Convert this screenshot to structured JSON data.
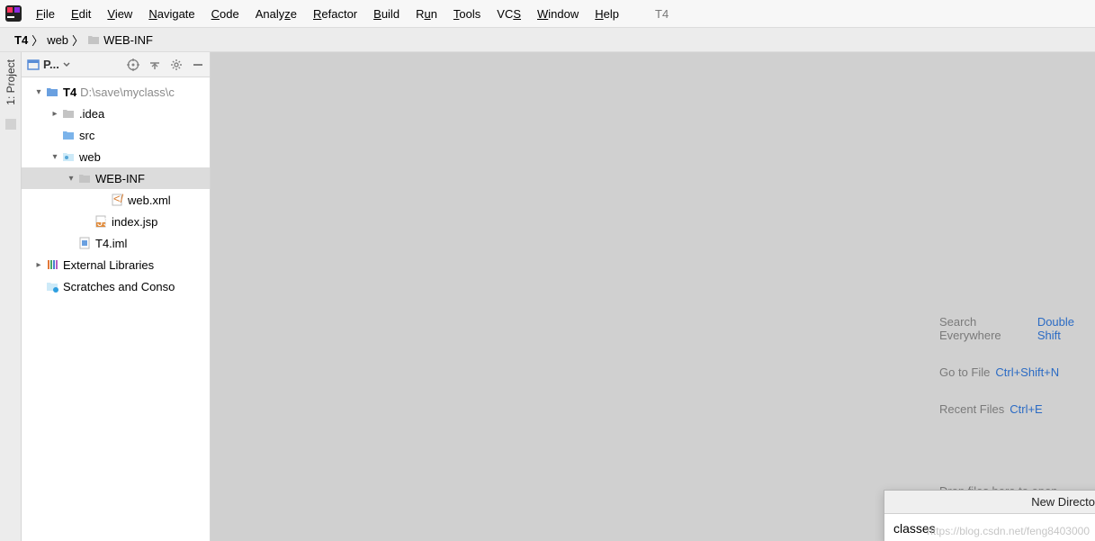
{
  "menubar": {
    "items": [
      "File",
      "Edit",
      "View",
      "Navigate",
      "Code",
      "Analyze",
      "Refactor",
      "Build",
      "Run",
      "Tools",
      "VCS",
      "Window",
      "Help"
    ],
    "context": "T4"
  },
  "breadcrumb": {
    "root": "T4",
    "mid": "web",
    "leaf": "WEB-INF"
  },
  "gutter": {
    "project_label": "1: Project"
  },
  "panel": {
    "title": "P...",
    "tree": {
      "root_name": "T4",
      "root_path": "D:\\save\\myclass\\c",
      "idea": ".idea",
      "src": "src",
      "web": "web",
      "webinf": "WEB-INF",
      "webxml": "web.xml",
      "indexjsp": "index.jsp",
      "t4iml": "T4.iml",
      "ext": "External Libraries",
      "scratch": "Scratches and Conso"
    }
  },
  "welcome": {
    "search_label": "Search Everywhere",
    "search_kb": "Double Shift",
    "goto_label": "Go to File",
    "goto_kb": "Ctrl+Shift+N",
    "recent_label": "Recent Files",
    "recent_kb": "Ctrl+E",
    "drop_label": "Drop files here to open"
  },
  "popup": {
    "title": "New Directory",
    "value": "classes"
  },
  "watermark": "https://blog.csdn.net/feng8403000"
}
